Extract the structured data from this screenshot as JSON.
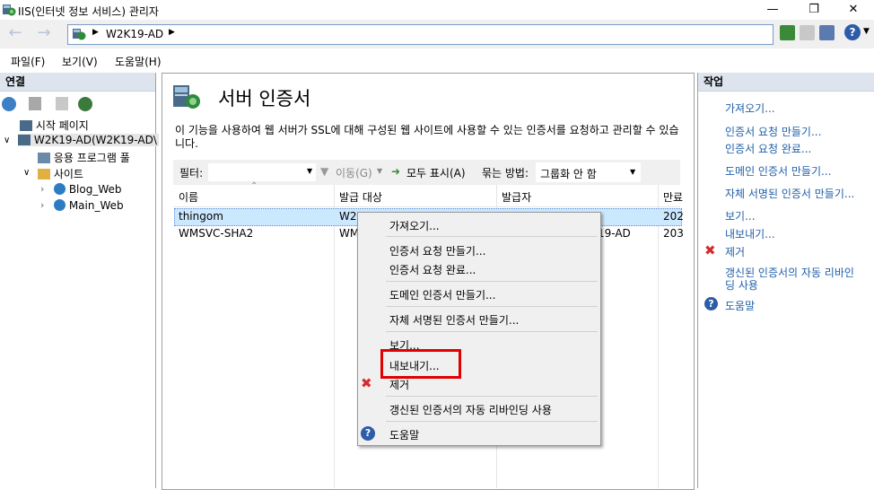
{
  "window": {
    "title": "IIS(인터넷 정보 서비스) 관리자"
  },
  "address": {
    "segments": [
      "W2K19-AD"
    ]
  },
  "menubar": {
    "items": [
      "파일(F)",
      "보기(V)",
      "도움말(H)"
    ]
  },
  "connections": {
    "header": "연결",
    "tree": {
      "start_page": "시작 페이지",
      "server": "W2K19-AD(W2K19-AD\\",
      "app_pools": "응용 프로그램 풀",
      "sites": "사이트",
      "site1": "Blog_Web",
      "site2": "Main_Web"
    }
  },
  "center": {
    "title": "서버 인증서",
    "description": "이 기능을 사용하여 웹 서버가 SSL에 대해 구성된 웹 사이트에 사용할 수 있는 인증서를 요청하고 관리할 수 있습니다.",
    "filter_label": "필터:",
    "go_label": "이동(G)",
    "show_all_label": "모두 표시(A)",
    "group_label": "묶는 방법:",
    "group_value": "그룹화 안 함",
    "columns": [
      "이름",
      "발급 대상",
      "발급자",
      "만료"
    ],
    "rows": [
      {
        "name": "thingom",
        "issued_to": "W2",
        "issuer": "",
        "expires": "202"
      },
      {
        "name": "WMSVC-SHA2",
        "issued_to": "WM",
        "issuer": "19-AD",
        "expires": "203"
      }
    ]
  },
  "context_menu": {
    "items": [
      "가져오기...",
      "인증서 요청 만들기...",
      "인증서 요청 완료...",
      "도메인 인증서 만들기...",
      "자체 서명된 인증서 만들기...",
      "보기...",
      "내보내기...",
      "제거",
      "갱신된 인증서의 자동 리바인딩 사용",
      "도움말"
    ],
    "highlighted": "내보내기..."
  },
  "actions": {
    "header": "작업",
    "import": "가져오기...",
    "create_request": "인증서 요청 만들기...",
    "complete_request": "인증서 요청 완료...",
    "create_domain": "도메인 인증서 만들기...",
    "create_self_signed": "자체 서명된 인증서 만들기...",
    "view": "보기...",
    "export": "내보내기...",
    "remove": "제거",
    "auto_rebind_1": "갱신된 인증서의 자동 리바인",
    "auto_rebind_2": "딩 사용",
    "help": "도움말"
  },
  "colors": {
    "accent": "#1f5fa8",
    "highlight_box": "#e00000",
    "selection": "#cce8ff"
  }
}
